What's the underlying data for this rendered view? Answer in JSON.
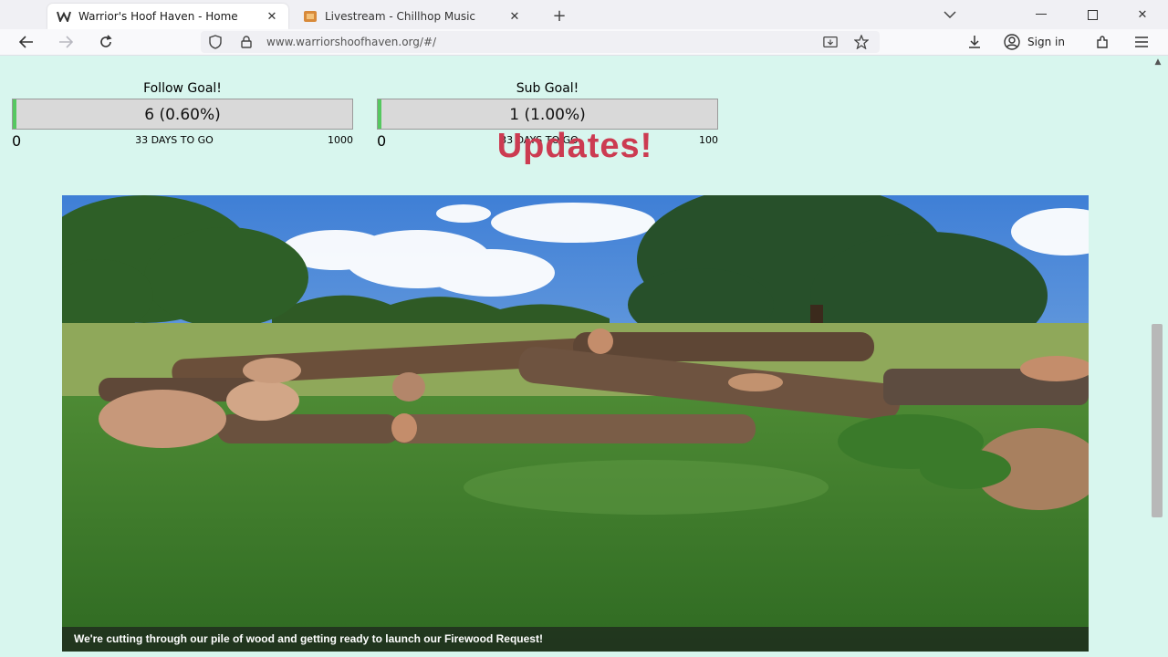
{
  "browser": {
    "tabs": [
      {
        "title": "Warrior's Hoof Haven - Home",
        "active": true,
        "favicon": "w-logo-icon"
      },
      {
        "title": "Livestream - Chillhop Music",
        "active": false,
        "favicon": "chillhop-logo-icon"
      }
    ],
    "url": "www.warriorshoofhaven.org/#/",
    "sign_in_label": "Sign in"
  },
  "goals": {
    "follow": {
      "title": "Follow Goal!",
      "value_label": "6 (0.60%)",
      "progress": 0.006,
      "min": "0",
      "max": "1000",
      "days_left": "33 DAYS TO GO"
    },
    "sub": {
      "title": "Sub Goal!",
      "value_label": "1 (1.00%)",
      "progress": 0.01,
      "min": "0",
      "max": "100",
      "days_left": "33 DAYS TO GO"
    }
  },
  "updates": {
    "heading": "Updates!",
    "caption": "We're cutting through our pile of wood and getting ready to launch our Firewood Request!"
  },
  "colors": {
    "page_background": "#d8f6ee",
    "progress_fill": "#55c860",
    "heading": "#cc3b51"
  }
}
